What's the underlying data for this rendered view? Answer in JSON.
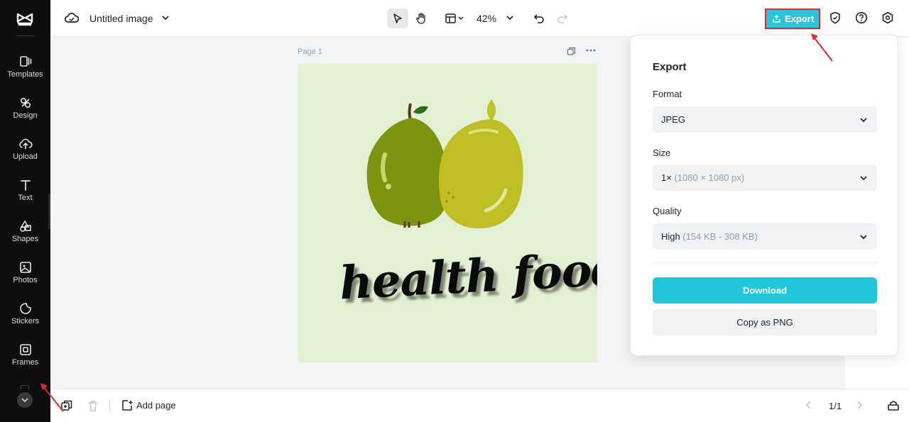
{
  "sidebar": {
    "items": [
      {
        "label": "Templates",
        "icon": "templates-icon"
      },
      {
        "label": "Design",
        "icon": "design-icon"
      },
      {
        "label": "Upload",
        "icon": "upload-icon"
      },
      {
        "label": "Text",
        "icon": "text-icon"
      },
      {
        "label": "Shapes",
        "icon": "shapes-icon"
      },
      {
        "label": "Photos",
        "icon": "photos-icon"
      },
      {
        "label": "Stickers",
        "icon": "stickers-icon"
      },
      {
        "label": "Frames",
        "icon": "frames-icon"
      }
    ]
  },
  "header": {
    "title": "Untitled image",
    "zoom": "42%",
    "export_label": "Export"
  },
  "canvas": {
    "page_label": "Page 1",
    "art_text": "health food"
  },
  "export_panel": {
    "title": "Export",
    "format_label": "Format",
    "format_value": "JPEG",
    "size_label": "Size",
    "size_value": "1×",
    "size_detail": "(1080 × 1080 px)",
    "quality_label": "Quality",
    "quality_value": "High",
    "quality_detail": "(154 KB - 308 KB)",
    "download_label": "Download",
    "copy_label": "Copy as PNG"
  },
  "footer": {
    "add_page_label": "Add page",
    "page_count": "1/1"
  },
  "colors": {
    "accent": "#22c5d9",
    "highlight_border": "#e0282e",
    "sidebar_bg": "#0f0f10",
    "artboard_bg": "#e3f0d3"
  }
}
